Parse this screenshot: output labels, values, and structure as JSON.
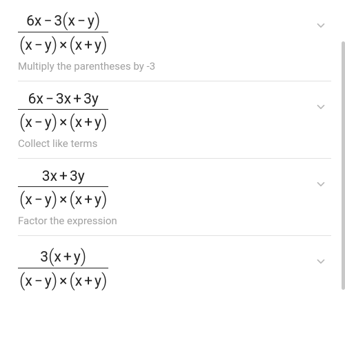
{
  "steps": [
    {
      "numerator_html": "6x<span class='op'>&minus;</span>3<span class='paren'>(</span>x<span class='op'>&minus;</span>y<span class='paren'>)</span>",
      "denominator_html": "<span class='paren'>(</span>x<span class='op'>&minus;</span>y<span class='paren'>)</span><span class='op'>&times;</span><span class='paren'>(</span>x<span class='op'>+</span>y<span class='paren'>)</span>",
      "caption": "Multiply the parentheses by -3"
    },
    {
      "numerator_html": "6x<span class='op'>&minus;</span>3x<span class='op'>+</span>3y",
      "denominator_html": "<span class='paren'>(</span>x<span class='op'>&minus;</span>y<span class='paren'>)</span><span class='op'>&times;</span><span class='paren'>(</span>x<span class='op'>+</span>y<span class='paren'>)</span>",
      "caption": "Collect like terms"
    },
    {
      "numerator_html": "3x<span class='op'>+</span>3y",
      "denominator_html": "<span class='paren'>(</span>x<span class='op'>&minus;</span>y<span class='paren'>)</span><span class='op'>&times;</span><span class='paren'>(</span>x<span class='op'>+</span>y<span class='paren'>)</span>",
      "caption": "Factor the expression"
    },
    {
      "numerator_html": "3<span class='paren'>(</span>x<span class='op'>+</span>y<span class='paren'>)</span>",
      "denominator_html": "<span class='paren'>(</span>x<span class='op'>&minus;</span>y<span class='paren'>)</span><span class='op'>&times;</span><span class='paren'>(</span>x<span class='op'>+</span>y<span class='paren'>)</span>",
      "caption": ""
    }
  ]
}
